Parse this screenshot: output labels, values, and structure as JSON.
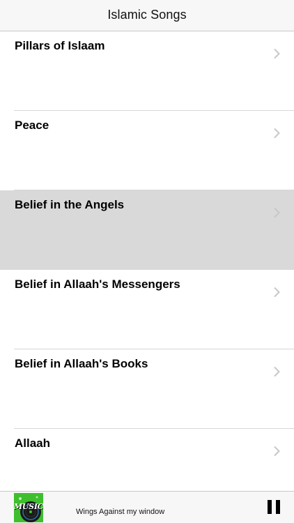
{
  "navbar": {
    "title": "Islamic Songs"
  },
  "list": {
    "rows": [
      {
        "label": "Pillars of Islaam",
        "selected": false,
        "icon": "chevron-right-icon"
      },
      {
        "label": "Peace",
        "selected": false,
        "icon": "chevron-right-icon"
      },
      {
        "label": "Belief in the Angels",
        "selected": true,
        "icon": "chevron-right-icon"
      },
      {
        "label": "Belief in Allaah's Messengers",
        "selected": false,
        "icon": "chevron-right-icon"
      },
      {
        "label": "Belief in Allaah's Books",
        "selected": false,
        "icon": "chevron-right-icon"
      },
      {
        "label": "Allaah",
        "selected": false,
        "icon": "chevron-right-icon"
      }
    ]
  },
  "player": {
    "artwork_text": "MUSIC",
    "track_title": "Wings Against my window",
    "control_icon": "pause-icon"
  },
  "colors": {
    "navbar_background": "#f7f7f7",
    "selected_row": "#d9d9d9",
    "chevron": "#c7c7cc",
    "artwork_green": "#3fbf2e"
  }
}
